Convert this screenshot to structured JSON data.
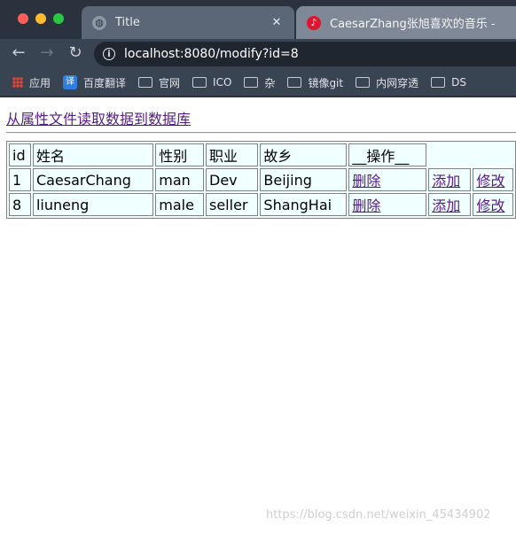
{
  "browser": {
    "tabs": [
      {
        "title": "Title",
        "icon": "globe-icon"
      },
      {
        "title": "CaesarZhang张旭喜欢的音乐 - ",
        "icon": "netease-music-icon"
      }
    ],
    "url": "localhost:8080/modify?id=8",
    "bookmarks": [
      {
        "label": "应用",
        "icon": "apps-grid-icon"
      },
      {
        "label": "百度翻译",
        "icon": "translate-icon",
        "badge": "译"
      },
      {
        "label": "官网",
        "icon": "folder-icon"
      },
      {
        "label": "ICO",
        "icon": "folder-icon"
      },
      {
        "label": "杂",
        "icon": "folder-icon"
      },
      {
        "label": "镜像git",
        "icon": "folder-icon"
      },
      {
        "label": "内网穿透",
        "icon": "folder-icon"
      },
      {
        "label": "DS",
        "icon": "folder-icon"
      }
    ]
  },
  "page": {
    "top_link": "从属性文件读取数据到数据库",
    "table": {
      "headers": [
        "id",
        "姓名",
        "性别",
        "职业",
        "故乡",
        "__操作__"
      ],
      "rows": [
        {
          "id": "1",
          "name": "CaesarChang",
          "gender": "man",
          "job": "Dev",
          "hometown": "Beijing",
          "delete": "删除",
          "add": "添加",
          "modify": "修改"
        },
        {
          "id": "8",
          "name": "liuneng",
          "gender": "male",
          "job": "seller",
          "hometown": "ShangHai",
          "delete": "删除",
          "add": "添加",
          "modify": "修改"
        }
      ]
    },
    "watermark": "https://blog.csdn.net/weixin_45434902"
  }
}
